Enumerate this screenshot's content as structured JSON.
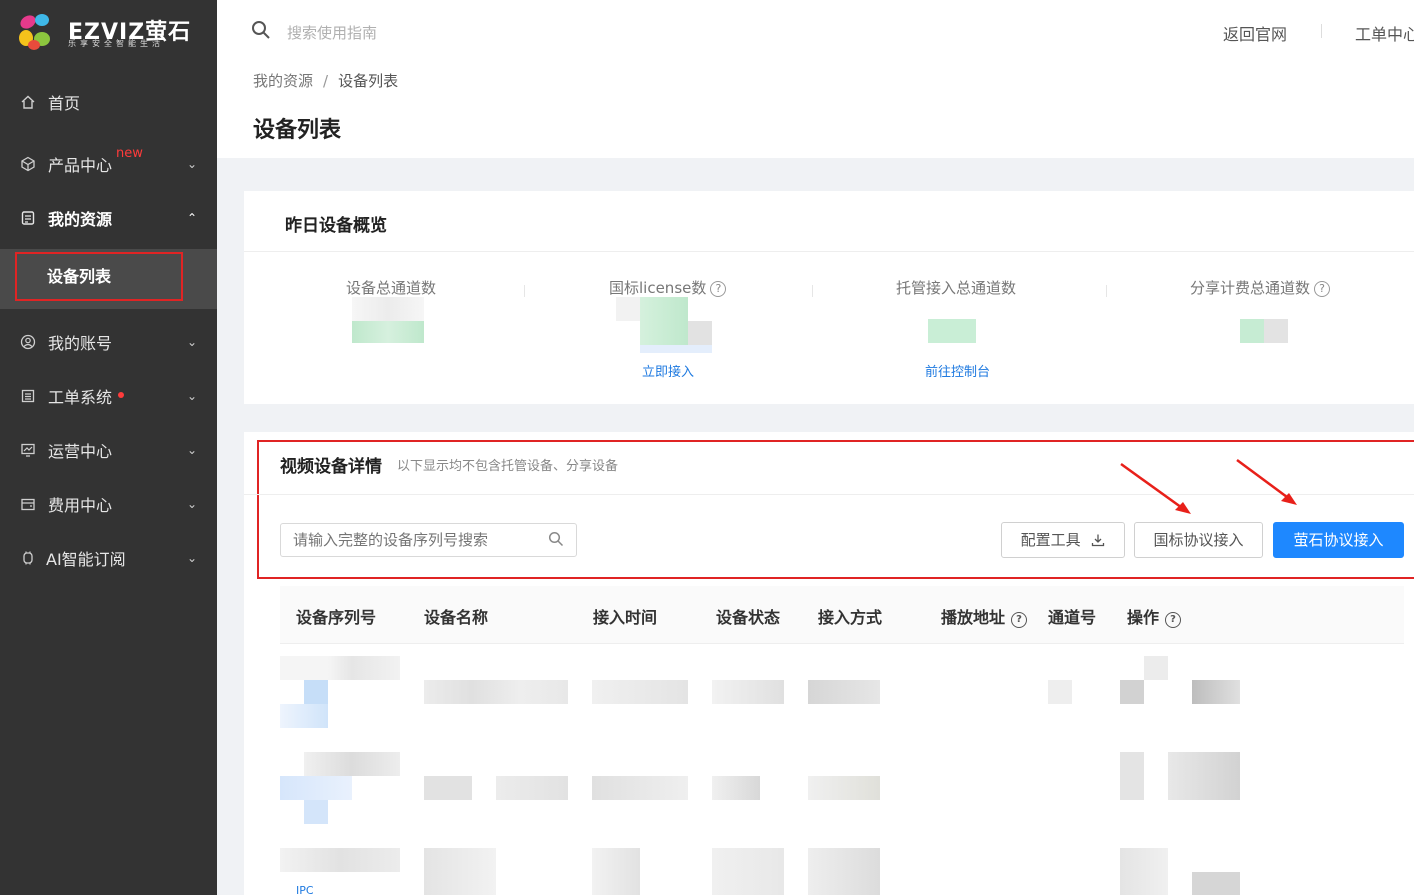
{
  "sidebar": {
    "logo_brand": "EZVIZ萤石",
    "logo_slogan": "乐享安全智能生活",
    "items": [
      {
        "label": "首页",
        "icon": "home-icon"
      },
      {
        "label": "产品中心",
        "icon": "cube-icon",
        "badge": "new"
      },
      {
        "label": "我的资源",
        "icon": "document-icon"
      },
      {
        "label": "我的账号",
        "icon": "user-icon"
      },
      {
        "label": "工单系统",
        "icon": "list-icon"
      },
      {
        "label": "运营中心",
        "icon": "chart-icon"
      },
      {
        "label": "费用中心",
        "icon": "wallet-icon"
      },
      {
        "label": "AI智能订阅",
        "icon": "ai-icon"
      }
    ],
    "sub_active": "设备列表"
  },
  "header": {
    "search_placeholder": "搜索使用指南",
    "link_home": "返回官网",
    "link_tickets": "工单中心"
  },
  "breadcrumb": {
    "root": "我的资源",
    "sep": "/",
    "current": "设备列表"
  },
  "page_title": "设备列表",
  "overview": {
    "title": "昨日设备概览",
    "stats": [
      {
        "label": "设备总通道数"
      },
      {
        "label": "国标license数",
        "link": "立即接入"
      },
      {
        "label": "托管接入总通道数",
        "link": "前往控制台"
      },
      {
        "label": "分享计费总通道数"
      }
    ]
  },
  "detail": {
    "title": "视频设备详情",
    "subtitle": "以下显示均不包含托管设备、分享设备",
    "search_placeholder": "请输入完整的设备序列号搜索",
    "btn_config": "配置工具",
    "btn_gb": "国标协议接入",
    "btn_ezviz": "萤石协议接入",
    "columns": [
      "设备序列号",
      "设备名称",
      "接入时间",
      "设备状态",
      "接入方式",
      "播放地址",
      "通道号",
      "操作"
    ],
    "row_tag": "IPC"
  },
  "colors": {
    "accent": "#1e88ff",
    "highlight_red": "#e02424",
    "sidebar_bg": "#333333"
  }
}
